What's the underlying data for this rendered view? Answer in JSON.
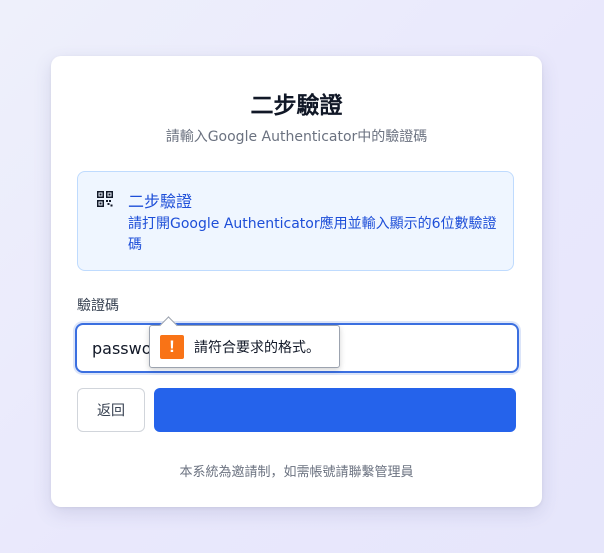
{
  "page": {
    "title": "二步驗證",
    "subtitle": "請輸入Google Authenticator中的驗證碼"
  },
  "info": {
    "icon": "qr-code-icon",
    "title": "二步驗證",
    "text": "請打開Google Authenticator應用並輸入顯示的6位數驗證碼"
  },
  "form": {
    "code_label": "驗證碼",
    "code_value": "password123",
    "back_label": "返回",
    "submit_label": ""
  },
  "validation": {
    "icon": "warning-icon",
    "symbol": "!",
    "message": "請符合要求的格式。"
  },
  "footer": {
    "text": "本系統為邀請制，如需帳號請聯繫管理員"
  },
  "colors": {
    "accent": "#2563eb",
    "info_bg": "#eff6ff",
    "info_text": "#1d4ed8",
    "warning": "#f97316"
  }
}
